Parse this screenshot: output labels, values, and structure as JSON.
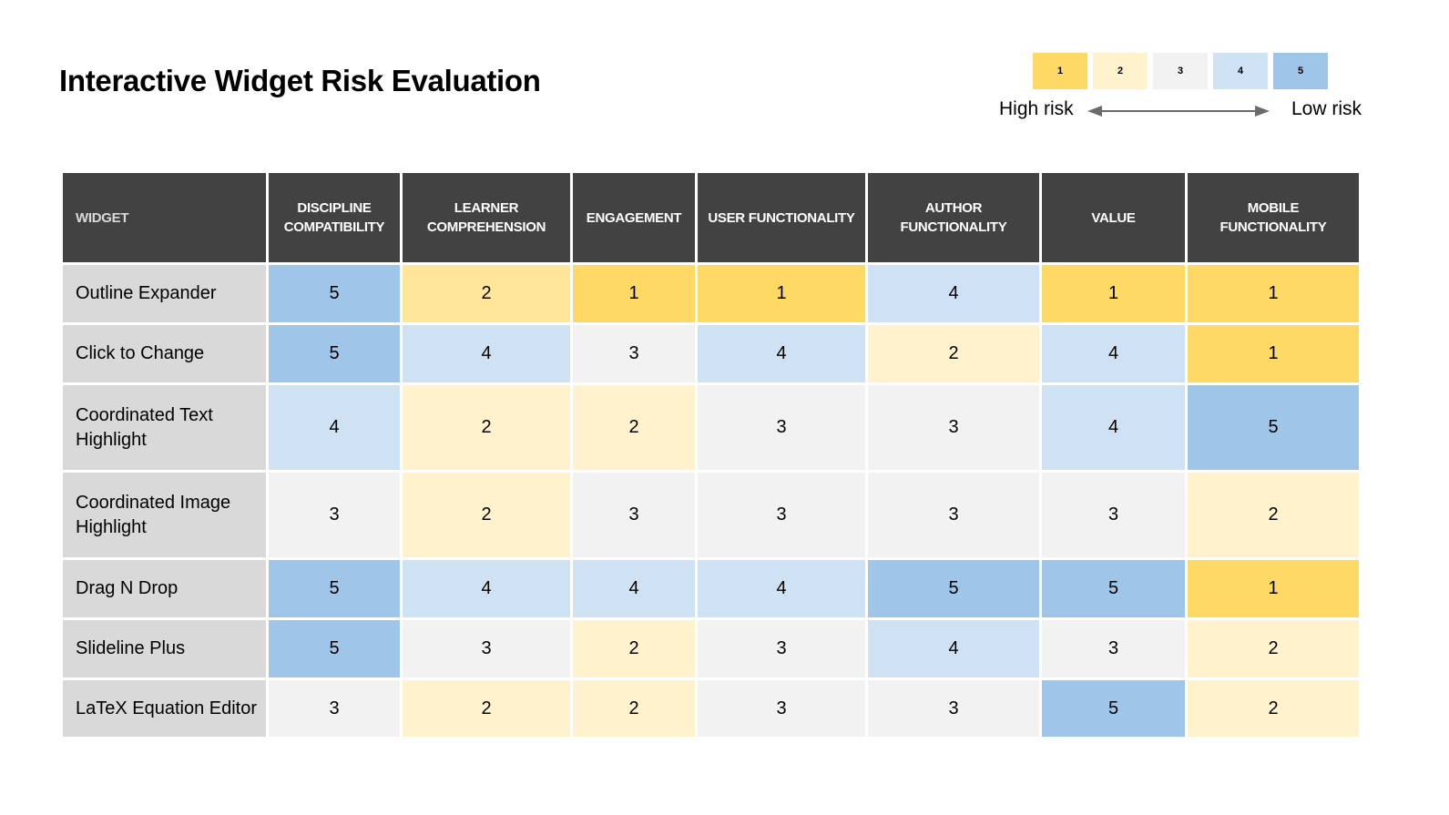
{
  "title": "Interactive Widget Risk Evaluation",
  "legend": {
    "scale": [
      {
        "value": "1",
        "color": "#ffd966"
      },
      {
        "value": "2",
        "color": "#fff2cc"
      },
      {
        "value": "3",
        "color": "#f2f2f2"
      },
      {
        "value": "4",
        "color": "#cfe2f3"
      },
      {
        "value": "5",
        "color": "#9fc5e8"
      }
    ],
    "high_label": "High risk",
    "low_label": "Low risk"
  },
  "table": {
    "headers": [
      "WIDGET",
      "DISCIPLINE COMPATIBILITY",
      "LEARNER COMPREHENSION",
      "ENGAGEMENT",
      "USER FUNCTIONALITY",
      "AUTHOR FUNCTIONALITY",
      "VALUE",
      "MOBILE FUNCTIONALITY"
    ],
    "rows": [
      {
        "name": "Outline Expander",
        "values": [
          "5",
          "2",
          "1",
          "1",
          "4",
          "1",
          "1"
        ]
      },
      {
        "name": "Click to Change",
        "values": [
          "5",
          "4",
          "3",
          "4",
          "2",
          "4",
          "1"
        ]
      },
      {
        "name": "Coordinated Text Highlight",
        "values": [
          "4",
          "2",
          "2",
          "3",
          "3",
          "4",
          "5"
        ]
      },
      {
        "name": "Coordinated Image Highlight",
        "values": [
          "3",
          "2",
          "3",
          "3",
          "3",
          "3",
          "2"
        ]
      },
      {
        "name": "Drag N Drop",
        "values": [
          "5",
          "4",
          "4",
          "4",
          "5",
          "5",
          "1"
        ]
      },
      {
        "name": "Slideline Plus",
        "values": [
          "5",
          "3",
          "2",
          "3",
          "4",
          "3",
          "2"
        ]
      },
      {
        "name": "LaTeX Equation Editor",
        "values": [
          "3",
          "2",
          "2",
          "3",
          "3",
          "5",
          "2"
        ]
      }
    ]
  },
  "colors": {
    "header_bg": "#424242",
    "name_cell_bg": "#d9d9d9",
    "outline_expander_learner_highlight": "#ffe699"
  }
}
